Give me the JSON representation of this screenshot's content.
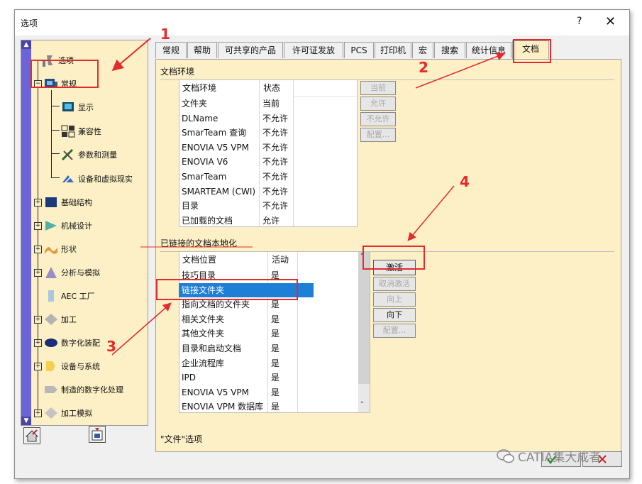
{
  "window": {
    "title": "选项",
    "help": "?",
    "close": "✕"
  },
  "tree": {
    "items": [
      {
        "label": "选项"
      },
      {
        "label": "常规"
      },
      {
        "label": "显示"
      },
      {
        "label": "兼容性"
      },
      {
        "label": "参数和测量"
      },
      {
        "label": "设备和虚拟现实"
      },
      {
        "label": "基础结构"
      },
      {
        "label": "机械设计"
      },
      {
        "label": "形状"
      },
      {
        "label": "分析与模拟"
      },
      {
        "label": "AEC 工厂"
      },
      {
        "label": "加工"
      },
      {
        "label": "数字化装配"
      },
      {
        "label": "设备与系统"
      },
      {
        "label": "制造的数字化处理"
      },
      {
        "label": "加工模拟"
      }
    ],
    "scroll_up": "▲",
    "scroll_down": "▼"
  },
  "tabs": [
    {
      "label": "常规"
    },
    {
      "label": "帮助"
    },
    {
      "label": "可共享的产品"
    },
    {
      "label": "许可证发放"
    },
    {
      "label": "PCS"
    },
    {
      "label": "打印机"
    },
    {
      "label": "宏"
    },
    {
      "label": "搜索"
    },
    {
      "label": "统计信息"
    },
    {
      "label": "文档"
    }
  ],
  "doc_env": {
    "section_label": "文档环境",
    "col1": "文档环境",
    "col2": "状态",
    "rows": [
      {
        "name": "文件夹",
        "status": "当前"
      },
      {
        "name": "DLName",
        "status": "不允许"
      },
      {
        "name": "SmarTeam 查询",
        "status": "不允许"
      },
      {
        "name": "ENOVIA V5 VPM",
        "status": "不允许"
      },
      {
        "name": "ENOVIA V6",
        "status": "不允许"
      },
      {
        "name": "SmarTeam",
        "status": "不允许"
      },
      {
        "name": "SMARTEAM (CWI)",
        "status": "不允许"
      },
      {
        "name": "目录",
        "status": "不允许"
      },
      {
        "name": "已加载的文档",
        "status": "允许"
      }
    ],
    "buttons": [
      "当前",
      "允许",
      "不允许",
      "配置..."
    ]
  },
  "linked": {
    "section_label": "已链接的文档本地化",
    "col1": "文档位置",
    "col2": "活动",
    "rows": [
      {
        "name": "技巧目录",
        "status": "是"
      },
      {
        "name": "链接文件夹",
        "status": ""
      },
      {
        "name": "指向文档的文件夹",
        "status": "是"
      },
      {
        "name": "相关文件夹",
        "status": "是"
      },
      {
        "name": "其他文件夹",
        "status": "是"
      },
      {
        "name": "目录和启动文档",
        "status": "是"
      },
      {
        "name": "企业流程库",
        "status": "是"
      },
      {
        "name": "IPD",
        "status": "是"
      },
      {
        "name": "ENOVIA V5 VPM",
        "status": "是"
      },
      {
        "name": "ENOVIA VPM 数据库",
        "status": "是"
      }
    ],
    "buttons": [
      "激活",
      "取消激活",
      "向上",
      "向下",
      "配置..."
    ]
  },
  "footer": "\"文件\"选项",
  "annotations": [
    "1",
    "2",
    "3",
    "4"
  ],
  "watermark": "CATIA集大成者",
  "colors": {
    "panel": "#fdf0c7",
    "selection": "#1e7fd6",
    "annotation": "#e42b2b",
    "scrollbar": "#6d63d8"
  }
}
